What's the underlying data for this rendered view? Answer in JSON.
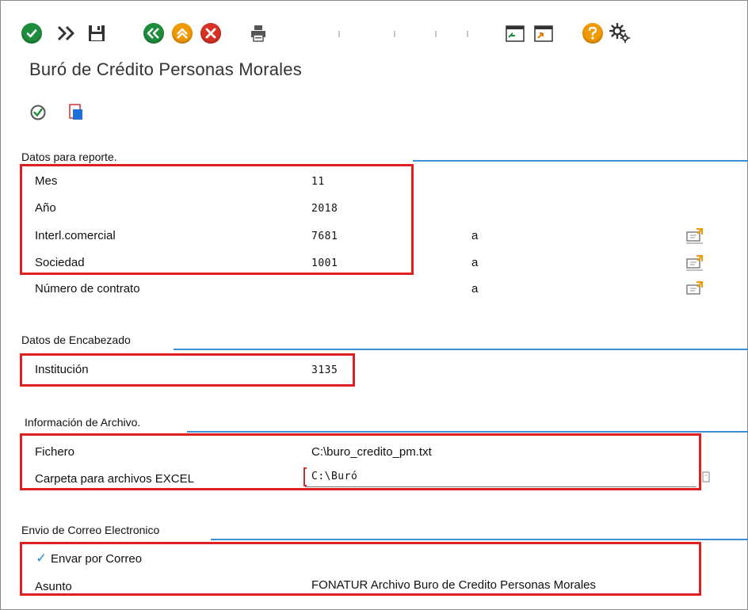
{
  "toolbar": {
    "icons": [
      "check-icon",
      "double-chevron-icon",
      "save-icon",
      "back-icon",
      "exit-icon",
      "cancel-icon",
      "print-icon",
      "layout-icon",
      "layout2-icon",
      "help-icon",
      "settings-icon"
    ]
  },
  "app": {
    "title": "Buró de Crédito Personas Morales"
  },
  "colors": {
    "section_rule": "#3b8fd6",
    "highlight": "#e02020",
    "ok_green": "#1e8e3e",
    "cancel_red": "#d93025",
    "exit_orange": "#f29900",
    "check_blue": "#1f8fd6"
  },
  "sections": {
    "report": {
      "label": "Datos para reporte.",
      "rows": [
        {
          "label": "Mes",
          "value": "11",
          "range": ""
        },
        {
          "label": "Año",
          "value": "2018",
          "range": ""
        },
        {
          "label": "Interl.comercial",
          "value": "7681",
          "range": "a"
        },
        {
          "label": "Sociedad",
          "value": "1001",
          "range": "a"
        },
        {
          "label": "Número de contrato",
          "value": "",
          "range": "a"
        }
      ]
    },
    "header": {
      "label": "Datos de Encabezado",
      "rows": [
        {
          "label": "Institución",
          "value": "3135"
        }
      ]
    },
    "file": {
      "label": "Información de Archivo.",
      "rows": [
        {
          "label": "Fichero",
          "value": "C:\\buro_credito_pm.txt"
        },
        {
          "label": "Carpeta para archivos EXCEL",
          "value": "C:\\Buró"
        }
      ]
    },
    "email": {
      "label": "Envio de Correo Electronico",
      "checkbox_label": "Envar por Correo",
      "checked": true,
      "subject_label": "Asunto",
      "subject_value": "FONATUR Archivo Buro de Credito Personas Morales"
    }
  }
}
